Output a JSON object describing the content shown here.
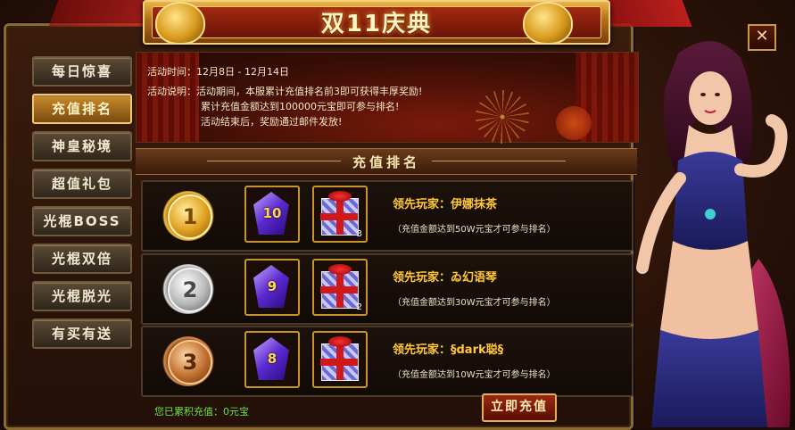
{
  "header": {
    "title": "双11庆典"
  },
  "close_icon": "close-icon",
  "sidebar": {
    "items": [
      {
        "label": "每日惊喜",
        "active": false
      },
      {
        "label": "充值排名",
        "active": true
      },
      {
        "label": "神皇秘境",
        "active": false
      },
      {
        "label": "超值礼包",
        "active": false
      },
      {
        "label": "光棍BOSS",
        "active": false
      },
      {
        "label": "光棍双倍",
        "active": false
      },
      {
        "label": "光棍脱光",
        "active": false
      },
      {
        "label": "有买有送",
        "active": false
      }
    ]
  },
  "info": {
    "time_label": "活动时间：",
    "time_value": "12月8日 - 12月14日",
    "desc_label": "活动说明：",
    "desc_lines": [
      "活动期间，本服累计充值排名前3即可获得丰厚奖励!",
      "累计充值金额达到100000元宝即可参与排名!",
      "活动结束后，奖励通过邮件发放!"
    ]
  },
  "section": {
    "title": "充值排名"
  },
  "ranks": [
    {
      "rank": "1",
      "gem": "10",
      "gift_count": "3",
      "leader": "领先玩家：伊娜抹茶",
      "condition": "（充值金额达到50W元宝才可参与排名）"
    },
    {
      "rank": "2",
      "gem": "9",
      "gift_count": "2",
      "leader": "领先玩家：ゐ幻语琴",
      "condition": "（充值金额达到30W元宝才可参与排名）"
    },
    {
      "rank": "3",
      "gem": "8",
      "gift_count": "",
      "leader": "领先玩家：§dark聪§",
      "condition": "（充值金额达到10W元宝才可参与排名）"
    }
  ],
  "footer": {
    "total_text": "您已累积充值：0元宝",
    "topup_label": "立即充值"
  },
  "colors": {
    "gold": "#c8952a",
    "leader": "#ffc838",
    "footer_green": "#6ee04a"
  }
}
